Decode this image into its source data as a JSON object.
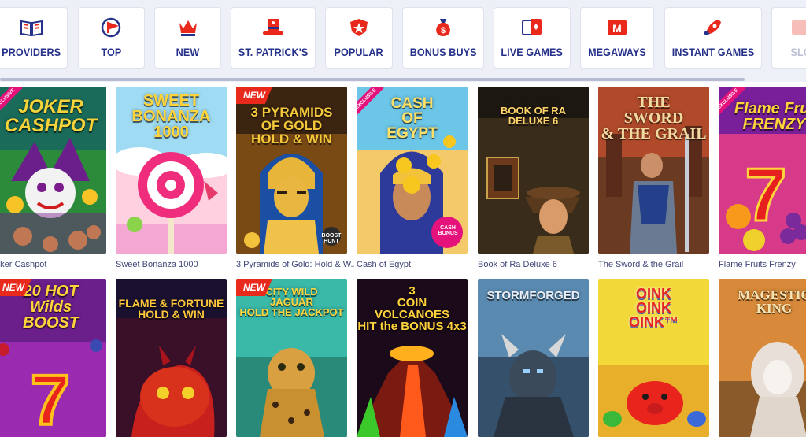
{
  "categories": [
    {
      "label": "PROVIDERS",
      "icon": "book-icon"
    },
    {
      "label": "TOP",
      "icon": "flag-icon"
    },
    {
      "label": "NEW",
      "icon": "crown-icon"
    },
    {
      "label": "ST. PATRICK'S",
      "icon": "leprechaun-hat-icon"
    },
    {
      "label": "POPULAR",
      "icon": "star-shield-icon"
    },
    {
      "label": "BONUS BUYS",
      "icon": "money-bag-icon"
    },
    {
      "label": "LIVE GAMES",
      "icon": "playing-cards-icon"
    },
    {
      "label": "MEGAWAYS",
      "icon": "megaways-icon"
    },
    {
      "label": "INSTANT GAMES",
      "icon": "rocket-icon"
    },
    {
      "label": "SLO",
      "icon": "slots-icon"
    }
  ],
  "games": [
    {
      "name": "oker Cashpot",
      "art_title": "JOKER\nCASHPOT",
      "badge": "EXCLUSIVE"
    },
    {
      "name": "Sweet Bonanza 1000",
      "art_title": "SWEET\nBONANZA\n1000"
    },
    {
      "name": "3 Pyramids of Gold: Hold & W...",
      "art_title": "3 PYRAMIDS\nOF GOLD\nHOLD & WIN",
      "badge": "NEW",
      "extra": "BOOST HUNT"
    },
    {
      "name": "Cash of Egypt",
      "art_title": "CASH\nOF\nEGYPT",
      "badge": "EXCLUSIVE",
      "extra": "CASH BONUS"
    },
    {
      "name": "Book of Ra Deluxe 6",
      "art_title": "BOOK OF RA\nDELUXE 6"
    },
    {
      "name": "The Sword & the Grail",
      "art_title": "THE\nSWORD\n& THE GRAIL"
    },
    {
      "name": "Flame Fruits Frenzy",
      "art_title": "Flame Frui\nFRENZY",
      "badge": "EXCLUSIVE"
    },
    {
      "art_title": "20 HOT\nWilds\nBOOST",
      "badge": "NEW"
    },
    {
      "art_title": "FLAME & FORTUNE\nHOLD & WIN"
    },
    {
      "art_title": "CITY WILD\nJAGUAR\nHOLD THE JACKPOT",
      "badge": "NEW"
    },
    {
      "art_title": "3\nCOIN\nVOLCANOES\nHIT the BONUS 4x3"
    },
    {
      "art_title": "STORMFORGED"
    },
    {
      "art_title": "OINK\nOINK\nOINK™"
    },
    {
      "art_title": "MAGESTIC\nKING"
    }
  ],
  "colors": {
    "nav_label": "#26318a",
    "accent": "#e8291c",
    "background": "#eef0f7"
  }
}
